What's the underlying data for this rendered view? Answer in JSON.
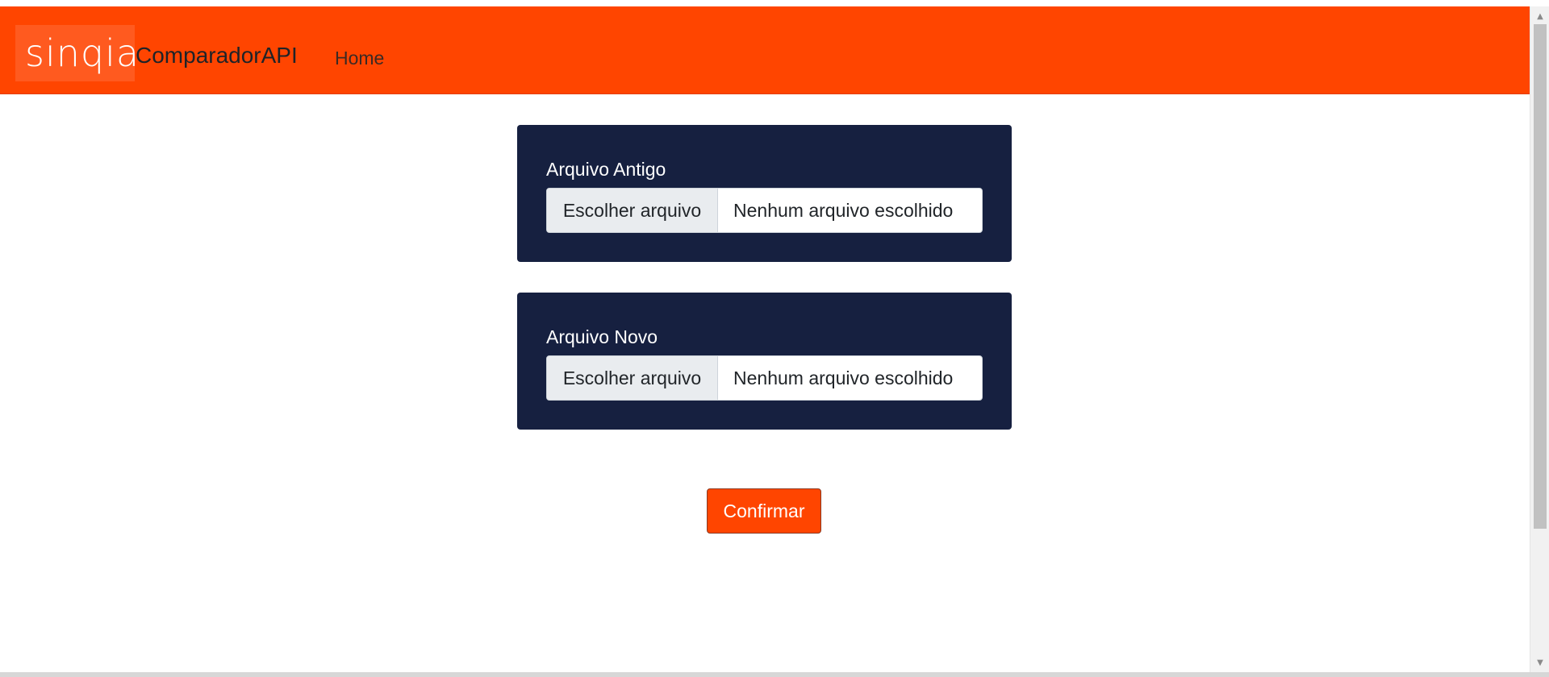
{
  "header": {
    "logo_text": "sinqia",
    "brand_name": "ComparadorAPI",
    "nav": {
      "home_label": "Home"
    },
    "accent_color": "#ff4500"
  },
  "main": {
    "old_file": {
      "label": "Arquivo Antigo",
      "button_label": "Escolher arquivo",
      "status_text": "Nenhum arquivo escolhido"
    },
    "new_file": {
      "label": "Arquivo Novo",
      "button_label": "Escolher arquivo",
      "status_text": "Nenhum arquivo escolhido"
    },
    "confirm_label": "Confirmar",
    "card_color": "#162040"
  },
  "scrollbar": {
    "up_icon": "scroll-up-arrow-icon",
    "down_icon": "scroll-down-arrow-icon"
  }
}
